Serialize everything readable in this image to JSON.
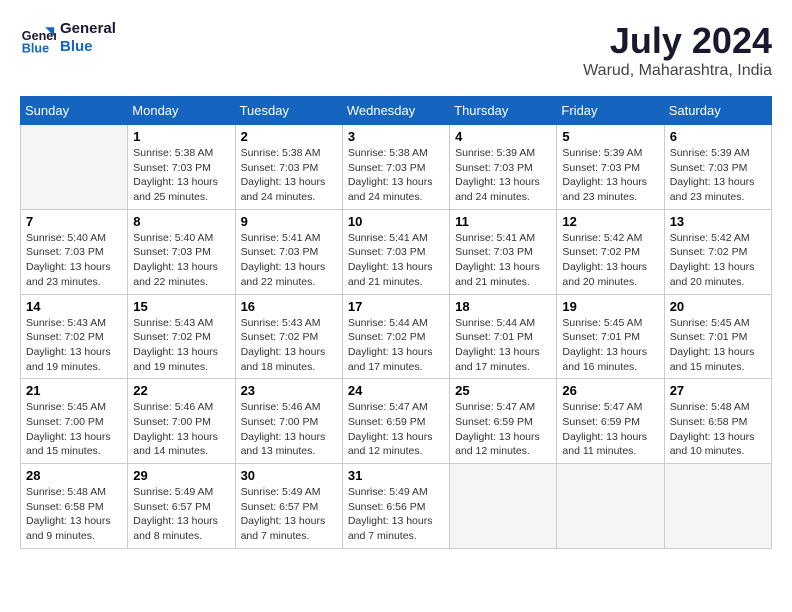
{
  "logo": {
    "line1": "General",
    "line2": "Blue"
  },
  "title": "July 2024",
  "location": "Warud, Maharashtra, India",
  "days_header": [
    "Sunday",
    "Monday",
    "Tuesday",
    "Wednesday",
    "Thursday",
    "Friday",
    "Saturday"
  ],
  "weeks": [
    [
      {
        "day": "",
        "empty": true
      },
      {
        "day": "1",
        "sunrise": "5:38 AM",
        "sunset": "7:03 PM",
        "daylight": "13 hours and 25 minutes."
      },
      {
        "day": "2",
        "sunrise": "5:38 AM",
        "sunset": "7:03 PM",
        "daylight": "13 hours and 24 minutes."
      },
      {
        "day": "3",
        "sunrise": "5:38 AM",
        "sunset": "7:03 PM",
        "daylight": "13 hours and 24 minutes."
      },
      {
        "day": "4",
        "sunrise": "5:39 AM",
        "sunset": "7:03 PM",
        "daylight": "13 hours and 24 minutes."
      },
      {
        "day": "5",
        "sunrise": "5:39 AM",
        "sunset": "7:03 PM",
        "daylight": "13 hours and 23 minutes."
      },
      {
        "day": "6",
        "sunrise": "5:39 AM",
        "sunset": "7:03 PM",
        "daylight": "13 hours and 23 minutes."
      }
    ],
    [
      {
        "day": "7",
        "sunrise": "5:40 AM",
        "sunset": "7:03 PM",
        "daylight": "13 hours and 23 minutes."
      },
      {
        "day": "8",
        "sunrise": "5:40 AM",
        "sunset": "7:03 PM",
        "daylight": "13 hours and 22 minutes."
      },
      {
        "day": "9",
        "sunrise": "5:41 AM",
        "sunset": "7:03 PM",
        "daylight": "13 hours and 22 minutes."
      },
      {
        "day": "10",
        "sunrise": "5:41 AM",
        "sunset": "7:03 PM",
        "daylight": "13 hours and 21 minutes."
      },
      {
        "day": "11",
        "sunrise": "5:41 AM",
        "sunset": "7:03 PM",
        "daylight": "13 hours and 21 minutes."
      },
      {
        "day": "12",
        "sunrise": "5:42 AM",
        "sunset": "7:02 PM",
        "daylight": "13 hours and 20 minutes."
      },
      {
        "day": "13",
        "sunrise": "5:42 AM",
        "sunset": "7:02 PM",
        "daylight": "13 hours and 20 minutes."
      }
    ],
    [
      {
        "day": "14",
        "sunrise": "5:43 AM",
        "sunset": "7:02 PM",
        "daylight": "13 hours and 19 minutes."
      },
      {
        "day": "15",
        "sunrise": "5:43 AM",
        "sunset": "7:02 PM",
        "daylight": "13 hours and 19 minutes."
      },
      {
        "day": "16",
        "sunrise": "5:43 AM",
        "sunset": "7:02 PM",
        "daylight": "13 hours and 18 minutes."
      },
      {
        "day": "17",
        "sunrise": "5:44 AM",
        "sunset": "7:02 PM",
        "daylight": "13 hours and 17 minutes."
      },
      {
        "day": "18",
        "sunrise": "5:44 AM",
        "sunset": "7:01 PM",
        "daylight": "13 hours and 17 minutes."
      },
      {
        "day": "19",
        "sunrise": "5:45 AM",
        "sunset": "7:01 PM",
        "daylight": "13 hours and 16 minutes."
      },
      {
        "day": "20",
        "sunrise": "5:45 AM",
        "sunset": "7:01 PM",
        "daylight": "13 hours and 15 minutes."
      }
    ],
    [
      {
        "day": "21",
        "sunrise": "5:45 AM",
        "sunset": "7:00 PM",
        "daylight": "13 hours and 15 minutes."
      },
      {
        "day": "22",
        "sunrise": "5:46 AM",
        "sunset": "7:00 PM",
        "daylight": "13 hours and 14 minutes."
      },
      {
        "day": "23",
        "sunrise": "5:46 AM",
        "sunset": "7:00 PM",
        "daylight": "13 hours and 13 minutes."
      },
      {
        "day": "24",
        "sunrise": "5:47 AM",
        "sunset": "6:59 PM",
        "daylight": "13 hours and 12 minutes."
      },
      {
        "day": "25",
        "sunrise": "5:47 AM",
        "sunset": "6:59 PM",
        "daylight": "13 hours and 12 minutes."
      },
      {
        "day": "26",
        "sunrise": "5:47 AM",
        "sunset": "6:59 PM",
        "daylight": "13 hours and 11 minutes."
      },
      {
        "day": "27",
        "sunrise": "5:48 AM",
        "sunset": "6:58 PM",
        "daylight": "13 hours and 10 minutes."
      }
    ],
    [
      {
        "day": "28",
        "sunrise": "5:48 AM",
        "sunset": "6:58 PM",
        "daylight": "13 hours and 9 minutes."
      },
      {
        "day": "29",
        "sunrise": "5:49 AM",
        "sunset": "6:57 PM",
        "daylight": "13 hours and 8 minutes."
      },
      {
        "day": "30",
        "sunrise": "5:49 AM",
        "sunset": "6:57 PM",
        "daylight": "13 hours and 7 minutes."
      },
      {
        "day": "31",
        "sunrise": "5:49 AM",
        "sunset": "6:56 PM",
        "daylight": "13 hours and 7 minutes."
      },
      {
        "day": "",
        "empty": true
      },
      {
        "day": "",
        "empty": true
      },
      {
        "day": "",
        "empty": true
      }
    ]
  ]
}
